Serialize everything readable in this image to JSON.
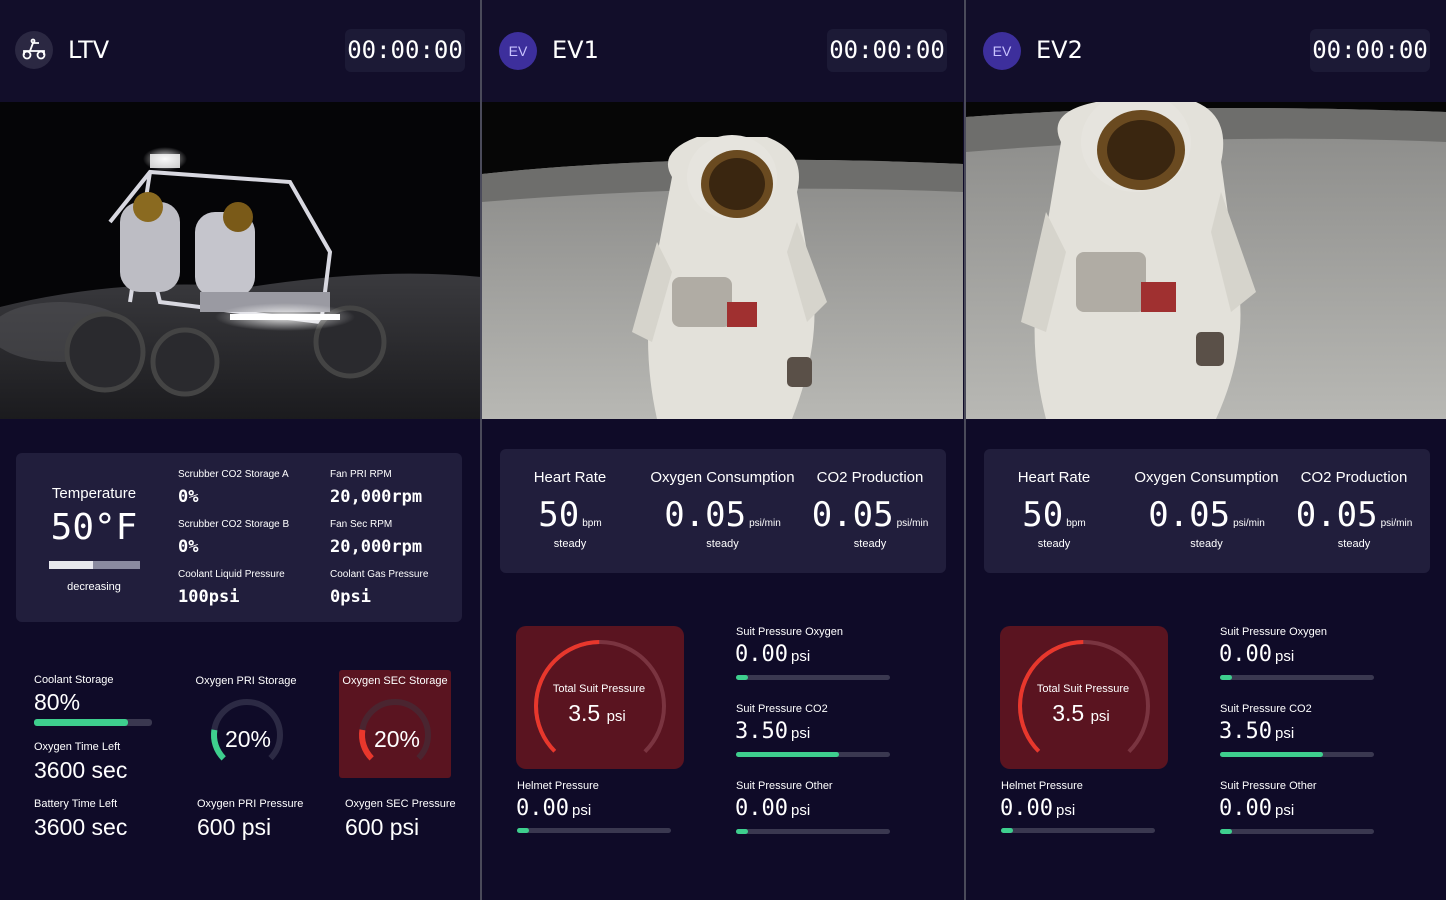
{
  "panels": [
    {
      "title": "LTV",
      "timer": "00:00:00",
      "icon": "rover-icon",
      "temperature": {
        "label": "Temperature",
        "value": "50°F",
        "trend": "decreasing"
      },
      "metrics": [
        {
          "label": "Scrubber CO2 Storage A",
          "value": "0%",
          "unit": ""
        },
        {
          "label": "Fan PRI RPM",
          "value": "20,000",
          "unit": "rpm"
        },
        {
          "label": "Scrubber CO2 Storage B",
          "value": "0%",
          "unit": ""
        },
        {
          "label": "Fan Sec RPM",
          "value": "20,000",
          "unit": "rpm"
        },
        {
          "label": "Coolant Liquid Pressure",
          "value": "100",
          "unit": "psi"
        },
        {
          "label": "Coolant Gas Pressure",
          "value": "0",
          "unit": "psi"
        }
      ],
      "coolant_storage": {
        "label": "Coolant Storage",
        "value": "80%",
        "level": 0.8
      },
      "oxygen_time_left": {
        "label": "Oxygen Time Left",
        "value": "3600 sec"
      },
      "battery_time_left": {
        "label": "Battery Time Left",
        "value": "3600 sec"
      },
      "oxygen_pri_storage": {
        "label": "Oxygen PRI Storage",
        "value": "20%",
        "level": 0.2
      },
      "oxygen_sec_storage": {
        "label": "Oxygen SEC Storage",
        "value": "20%",
        "level": 0.2
      },
      "oxygen_pri_pressure": {
        "label": "Oxygen PRI Pressure",
        "value": "600 psi"
      },
      "oxygen_sec_pressure": {
        "label": "Oxygen SEC Pressure",
        "value": "600 psi"
      }
    },
    {
      "title": "EV1",
      "badge": "EV",
      "timer": "00:00:00",
      "vitals": [
        {
          "label": "Heart Rate",
          "value": "50",
          "unit": "bpm",
          "trend": "steady"
        },
        {
          "label": "Oxygen Consumption",
          "value": "0.05",
          "unit": "psi/min",
          "trend": "steady"
        },
        {
          "label": "CO2 Production",
          "value": "0.05",
          "unit": "psi/min",
          "trend": "steady"
        }
      ],
      "total_suit_pressure": {
        "label": "Total Suit Pressure",
        "value": "3.5",
        "unit": "psi"
      },
      "pressures": [
        {
          "label": "Suit Pressure Oxygen",
          "value": "0.00",
          "unit": "psi",
          "level": 0.08
        },
        {
          "label": "Suit Pressure CO2",
          "value": "3.50",
          "unit": "psi",
          "level": 0.67
        },
        {
          "label": "Suit Pressure Other",
          "value": "0.00",
          "unit": "psi",
          "level": 0.08
        }
      ],
      "helmet_pressure": {
        "label": "Helmet Pressure",
        "value": "0.00",
        "unit": "psi",
        "level": 0.08
      }
    },
    {
      "title": "EV2",
      "badge": "EV",
      "timer": "00:00:00",
      "vitals": [
        {
          "label": "Heart Rate",
          "value": "50",
          "unit": "bpm",
          "trend": "steady"
        },
        {
          "label": "Oxygen Consumption",
          "value": "0.05",
          "unit": "psi/min",
          "trend": "steady"
        },
        {
          "label": "CO2 Production",
          "value": "0.05",
          "unit": "psi/min",
          "trend": "steady"
        }
      ],
      "total_suit_pressure": {
        "label": "Total Suit Pressure",
        "value": "3.5",
        "unit": "psi"
      },
      "pressures": [
        {
          "label": "Suit Pressure Oxygen",
          "value": "0.00",
          "unit": "psi",
          "level": 0.08
        },
        {
          "label": "Suit Pressure CO2",
          "value": "3.50",
          "unit": "psi",
          "level": 0.67
        },
        {
          "label": "Suit Pressure Other",
          "value": "0.00",
          "unit": "psi",
          "level": 0.08
        }
      ],
      "helmet_pressure": {
        "label": "Helmet Pressure",
        "value": "0.00",
        "unit": "psi",
        "level": 0.08
      }
    }
  ],
  "colors": {
    "accent_green": "#3ecf8e",
    "alert_red": "#e8372c",
    "alert_bg": "#5a1420",
    "card_bg": "#211e3c",
    "page_bg": "#0f0b28"
  }
}
